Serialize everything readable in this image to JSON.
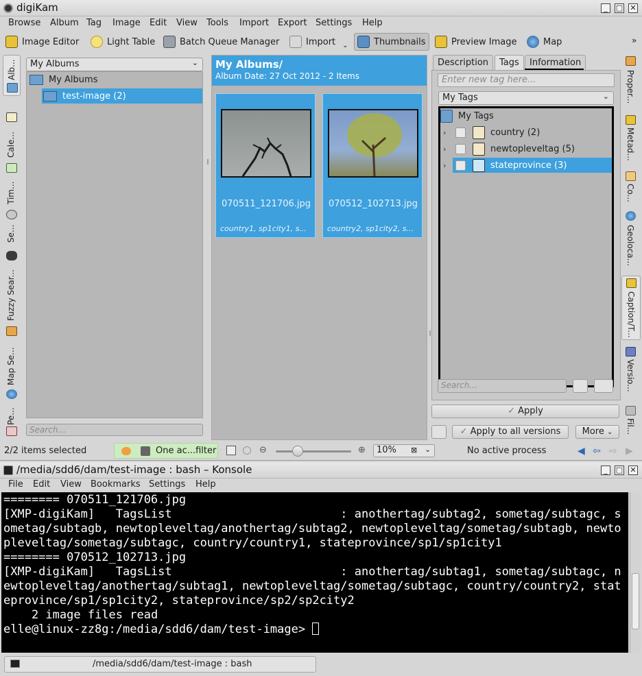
{
  "digikam": {
    "window_title": "digiKam",
    "menu": [
      "Browse",
      "Album",
      "Tag",
      "Image",
      "Edit",
      "View",
      "Tools",
      "Import",
      "Export",
      "Settings",
      "Help"
    ],
    "toolbar": {
      "image_editor": "Image Editor",
      "light_table": "Light Table",
      "batch_queue_manager": "Batch Queue Manager",
      "import": "Import",
      "thumbnails": "Thumbnails",
      "preview_image": "Preview Image",
      "map": "Map"
    },
    "left_tabs": [
      "Alb...",
      "Cale...",
      "Tim...",
      "Se...",
      "Fuzzy Sear...",
      "Map Se...",
      "Pe..."
    ],
    "albums": {
      "selector": "My Albums",
      "root": "My Albums",
      "child": "test-image (2)",
      "search_placeholder": "Search..."
    },
    "center": {
      "title": "My Albums/",
      "subtitle": "Album Date: 27 Oct 2012 - 2 Items",
      "items": [
        {
          "filename": "070511_121706.jpg",
          "tags": "country1, sp1city1, s..."
        },
        {
          "filename": "070512_102713.jpg",
          "tags": "country2, sp1city2, s..."
        }
      ]
    },
    "right_panel": {
      "tabs": [
        "Description",
        "Tags",
        "Information"
      ],
      "active_tab": "Tags",
      "new_tag_placeholder": "Enter new tag here...",
      "tag_selector": "My Tags",
      "root_tag": "My Tags",
      "tags": [
        {
          "label": "country (2)",
          "selected": false
        },
        {
          "label": "newtopleveltag (5)",
          "selected": false
        },
        {
          "label": "stateprovince (3)",
          "selected": true
        }
      ],
      "search_placeholder": "Search...",
      "apply": "Apply",
      "apply_all": "Apply to all versions",
      "more": "More"
    },
    "right_tabs": [
      "Proper...",
      "Metad...",
      "Co...",
      "Geoloca...",
      "Caption/T...",
      "Versio...",
      "Fil..."
    ],
    "status": {
      "selection": "2/2 items selected",
      "filter": "One ac...filter",
      "zoom": "10%",
      "process": "No active process"
    },
    "colors": {
      "accent": "#3ea0dd",
      "panel": "#b7b7b7",
      "filter_bg": "#cdecc0"
    }
  },
  "konsole": {
    "window_title": "/media/sdd6/dam/test-image : bash – Konsole",
    "menu": [
      "File",
      "Edit",
      "View",
      "Bookmarks",
      "Settings",
      "Help"
    ],
    "lines": [
      "======== 070511_121706.jpg",
      "[XMP-digiKam]   TagsList                        : anothertag/subtag2, sometag/subtagc, sometag/subtagb, newtopleveltag/anothertag/subtag2, newtopleveltag/sometag/subtagb, newtopleveltag/sometag/subtagc, country/country1, stateprovince/sp1/sp1city1",
      "======== 070512_102713.jpg",
      "[XMP-digiKam]   TagsList                        : anothertag/subtag1, sometag/subtagc, newtopleveltag/anothertag/subtag1, newtopleveltag/sometag/subtagc, country/country2, stateprovince/sp1/sp1city2, stateprovince/sp2/sp2city2",
      "    2 image files read"
    ],
    "prompt": "elle@linux-zz8g:/media/sdd6/dam/test-image> ",
    "tab_label": "/media/sdd6/dam/test-image : bash"
  }
}
